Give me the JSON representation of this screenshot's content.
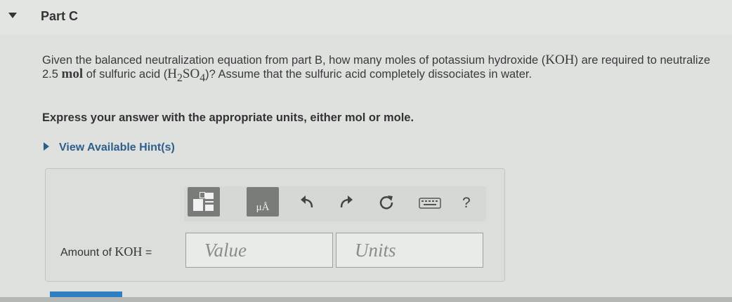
{
  "part": {
    "title": "Part C"
  },
  "question": {
    "t1": "Given the balanced neutralization equation from part B, how many moles of potassium hydroxide (",
    "koh": "KOH",
    "t2": ") are required to neutralize 2.5 ",
    "mol": "mol",
    "t3": " of sulfuric acid (",
    "h": "H",
    "sub2": "2",
    "so": "SO",
    "sub4": "4",
    "t4": ")? Assume that the sulfuric acid completely dissociates in water."
  },
  "instruction": "Express your answer with the appropriate units, either mol or mole.",
  "hint": {
    "label": "View Available Hint(s)"
  },
  "toolbar": {
    "units_label": "μÅ",
    "help_label": "?",
    "icons": [
      "templates-icon",
      "units-icon",
      "undo-icon",
      "redo-icon",
      "reset-icon",
      "keyboard-icon",
      "help-icon"
    ]
  },
  "answer": {
    "label_prefix": "Amount of ",
    "label_koh": "KOH",
    "label_suffix": " =",
    "value_placeholder": "Value",
    "units_placeholder": "Units"
  },
  "colors": {
    "link": "#2e5f8c",
    "submit": "#2f7ec1",
    "tool_button": "#7a7c7a"
  }
}
